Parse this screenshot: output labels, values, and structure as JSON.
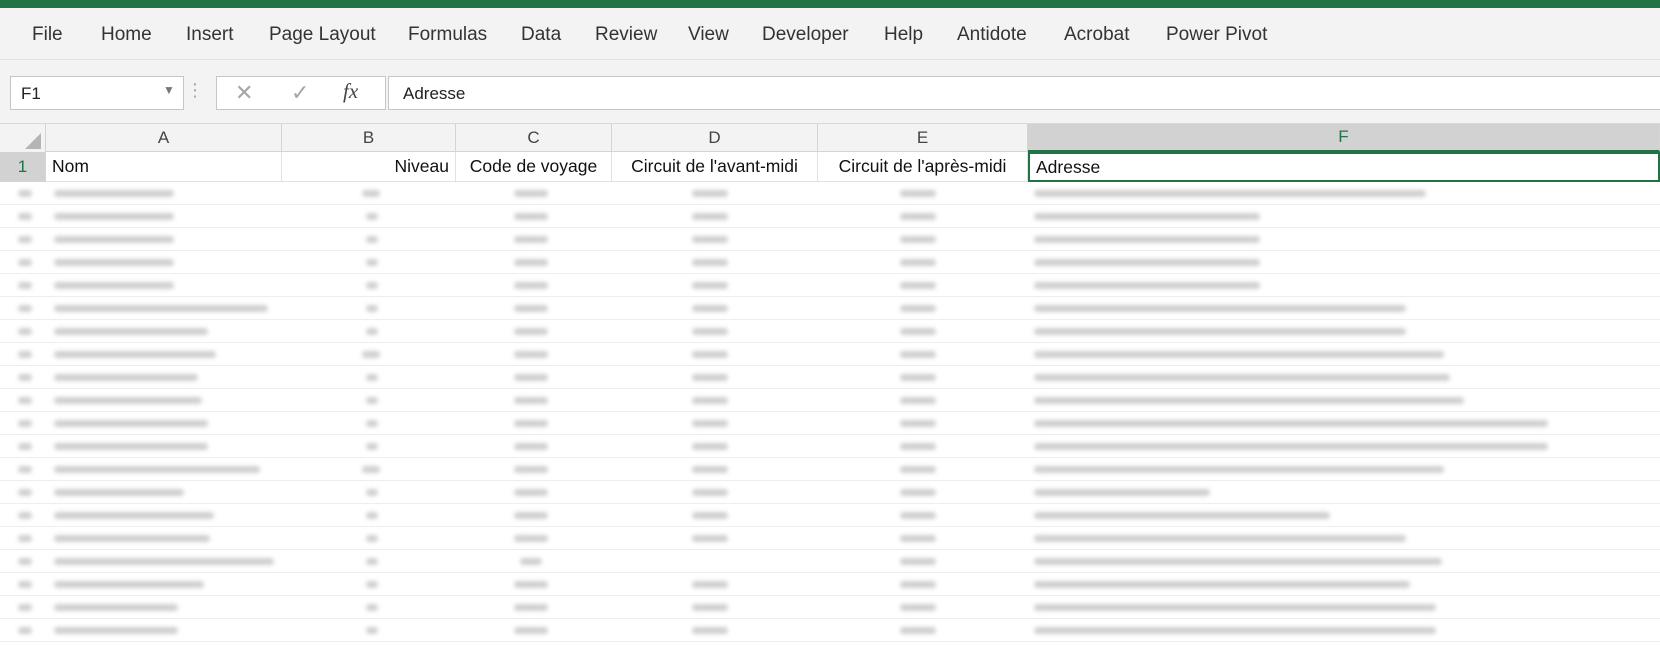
{
  "ribbon": {
    "tabs": [
      "File",
      "Home",
      "Insert",
      "Page Layout",
      "Formulas",
      "Data",
      "Review",
      "View",
      "Developer",
      "Help",
      "Antidote",
      "Acrobat",
      "Power Pivot"
    ]
  },
  "formula_bar": {
    "name_box": "F1",
    "cancel_glyph": "✕",
    "enter_glyph": "✓",
    "fx_label": "fx",
    "value": "Adresse"
  },
  "sheet": {
    "columns": [
      "A",
      "B",
      "C",
      "D",
      "E",
      "F"
    ],
    "selected_column": "F",
    "header_row_number": "1",
    "headers": [
      "Nom",
      "Niveau",
      "Code de voyage",
      "Circuit de l'avant-midi",
      "Circuit de l'après-midi",
      "Adresse"
    ],
    "active_cell": "F1"
  },
  "colors": {
    "accent_green": "#217346",
    "ribbon_bg": "#f3f3f3"
  }
}
